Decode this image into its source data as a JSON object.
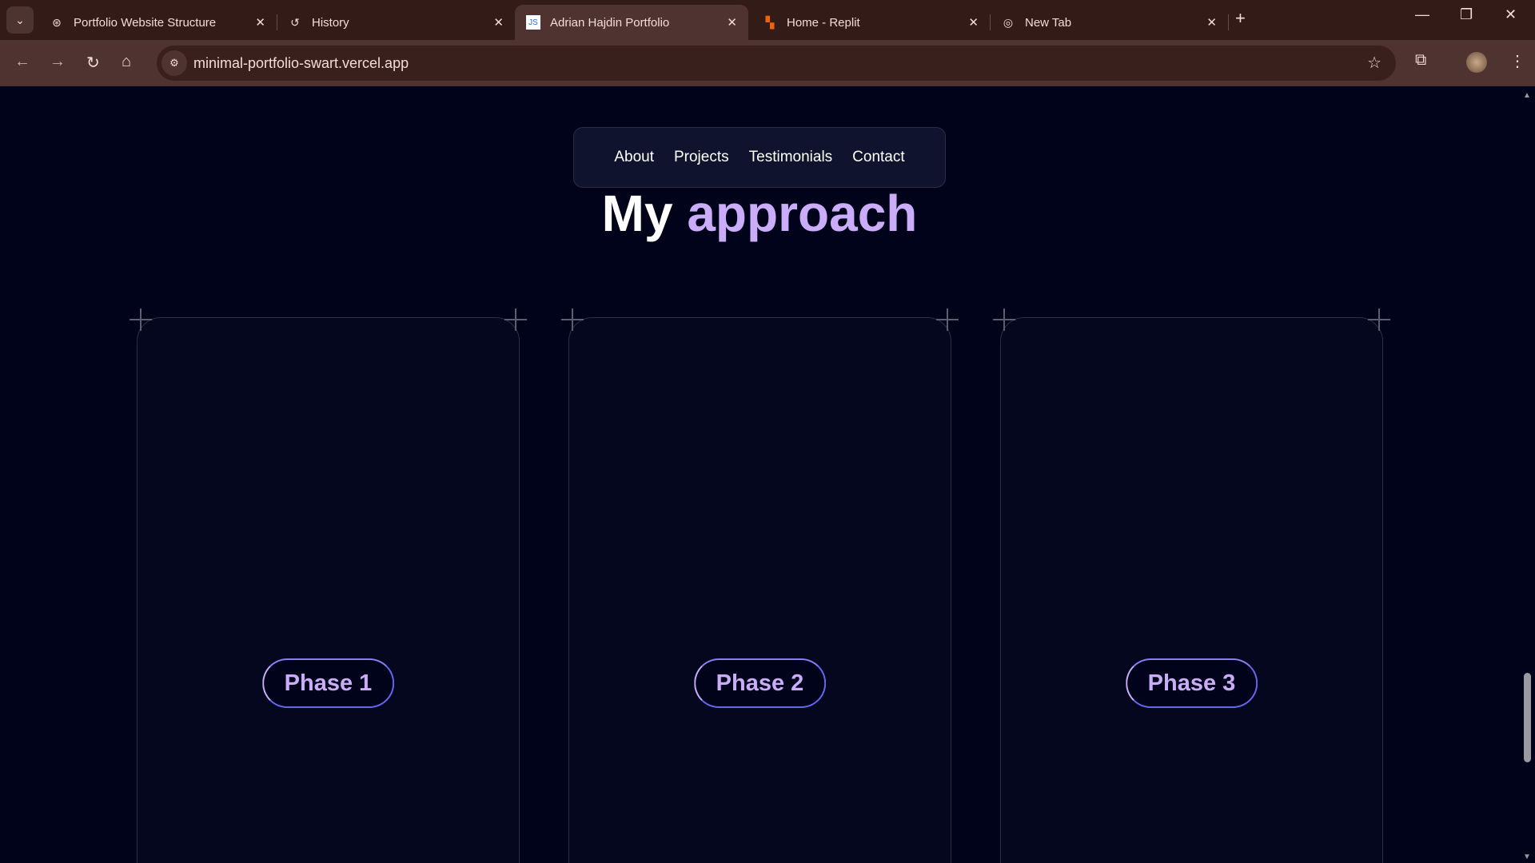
{
  "browser": {
    "tabs": [
      {
        "title": "Portfolio Website Structure",
        "icon": "openai-icon",
        "active": false
      },
      {
        "title": "History",
        "icon": "history-icon",
        "active": false
      },
      {
        "title": "Adrian Hajdin Portfolio",
        "icon": "site-favicon-icon",
        "active": true
      },
      {
        "title": "Home - Replit",
        "icon": "replit-icon",
        "active": false
      },
      {
        "title": "New Tab",
        "icon": "chrome-icon",
        "active": false
      }
    ],
    "url": "minimal-portfolio-swart.vercel.app"
  },
  "page": {
    "nav": [
      "About",
      "Projects",
      "Testimonials",
      "Contact"
    ],
    "heading": {
      "prefix": "My",
      "highlight": "approach"
    },
    "phases": [
      "Phase 1",
      "Phase 2",
      "Phase 3"
    ],
    "accent": "#cbacf9"
  }
}
